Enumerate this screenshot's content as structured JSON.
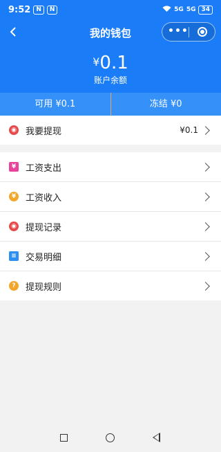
{
  "status_bar": {
    "time": "9:52",
    "badge1": "N",
    "badge2": "N",
    "signal1": "5G",
    "signal2": "5G",
    "battery": "34"
  },
  "nav": {
    "title": "我的钱包",
    "more": "•••"
  },
  "balance": {
    "currency": "¥",
    "amount": "0.1",
    "label": "账户余额"
  },
  "summary": {
    "available": "可用 ¥0.1",
    "frozen": "冻结 ¥0"
  },
  "rows": [
    {
      "label": "我要提现",
      "value": "¥0.1",
      "icon": "withdraw-icon",
      "color": "#e84a4a"
    },
    {
      "label": "工资支出",
      "value": "",
      "icon": "salary-expense-icon",
      "color": "#e8439a"
    },
    {
      "label": "工资收入",
      "value": "",
      "icon": "salary-income-icon",
      "color": "#f2a62a"
    },
    {
      "label": "提现记录",
      "value": "",
      "icon": "withdraw-record-icon",
      "color": "#e84a4a"
    },
    {
      "label": "交易明细",
      "value": "",
      "icon": "transaction-detail-icon",
      "color": "#2d8ff0"
    },
    {
      "label": "提现规则",
      "value": "",
      "icon": "rules-icon",
      "color": "#f2a62a"
    }
  ]
}
